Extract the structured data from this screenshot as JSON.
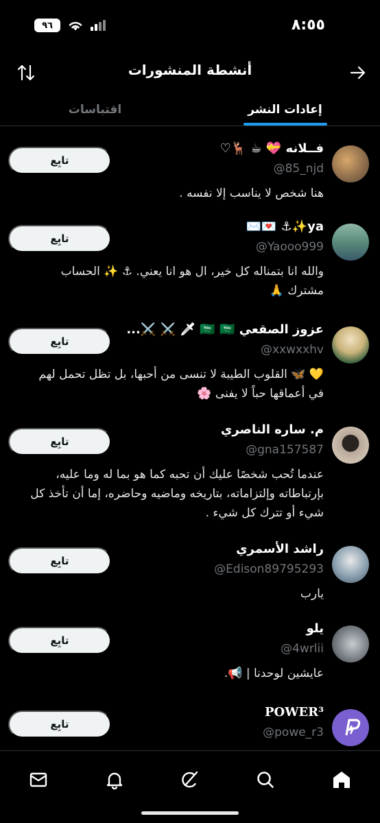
{
  "status": {
    "time": "٨:٥٥",
    "battery": "٩٦"
  },
  "header": {
    "title": "أنشطة المنشورات"
  },
  "tabs": [
    {
      "label": "إعادات النشر",
      "active": true
    },
    {
      "label": "اقتباسات",
      "active": false
    }
  ],
  "follow_label": "تابِع",
  "users": [
    {
      "name": "فــلانه 💝 ☕ 🦌♡",
      "handle": "@85_njd",
      "bio": "هنا شخص لا يناسب إلا نفسه .",
      "avatar_color": "#8a6a4a"
    },
    {
      "name": "ya✨⚓ 💌✉️",
      "handle": "@Yaooo999",
      "bio": "والله انا بتمناله كل خير، ال هو انا يعني. ⚓ ✨ الحساب مشترك 🙏",
      "avatar_color": "#5a8a7a"
    },
    {
      "name": "عزوز الصقعي 🇸🇦 🇸🇦 🗡 ⚔️ ⚔️...",
      "handle": "@xxwxxhv",
      "bio": "💛 🦋 القلوب الطيبة لا تنسى من أحبها، بل تظل تحمل لهم في أعماقها حباً لا يفنى 🌸",
      "avatar_color": "#c9b37a"
    },
    {
      "name": "م. ساره الناصري",
      "handle": "@gna157587",
      "bio": "عندما تُحب شخصًا عليك أن تحبه كما هو بما له وما عليه، بإرتباطاته وإلتزاماته، بتاريخه وماضيه وحاضره، إما أن تأخذ كل شيء أو تترك كل شيء .",
      "avatar_color": "#b8a89a"
    },
    {
      "name": "راشد الأسمري",
      "handle": "@Edison89795293",
      "bio": "يارب",
      "avatar_color": "#8aa0b0"
    },
    {
      "name": "يلو",
      "handle": "@4wrlii",
      "bio": "عايشين لوحدنا | 📢.",
      "avatar_color": "#7a7f86"
    },
    {
      "name": "POWER³",
      "handle": "@powe_r3",
      "bio": "",
      "avatar_color": "#7a5fd0"
    }
  ],
  "nav": [
    {
      "icon": "home-icon",
      "active": true
    },
    {
      "icon": "search-icon",
      "active": false
    },
    {
      "icon": "grok-icon",
      "active": false
    },
    {
      "icon": "bell-icon",
      "active": false
    },
    {
      "icon": "mail-icon",
      "active": false
    }
  ]
}
